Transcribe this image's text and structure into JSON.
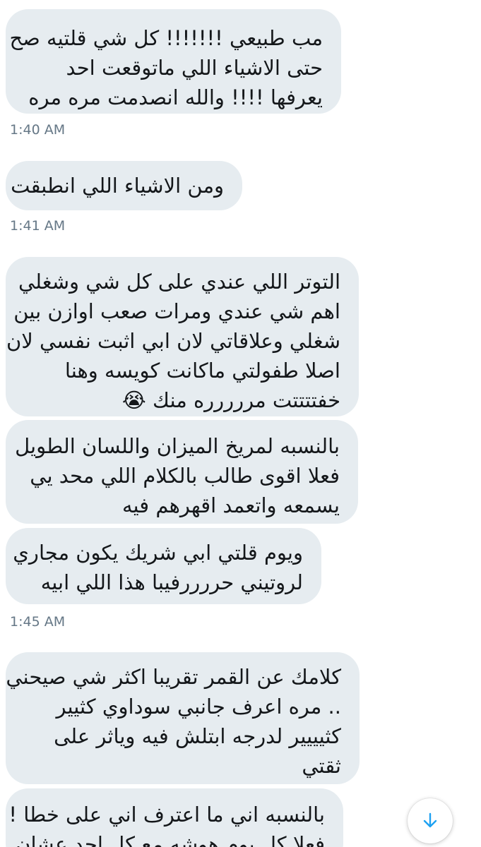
{
  "messages": [
    {
      "lines": [
        "مب طبيعي !!!!!!! كل شي قلتيه صح",
        "حتى الاشياء اللي ماتوقعت احد",
        "يعرفها !!!! والله انصدمت مره مره"
      ]
    },
    {
      "lines": [
        "ومن الاشياء اللي انطبقت"
      ]
    },
    {
      "lines": [
        "التوتر اللي عندي على كل شي وشغلي",
        "اهم شي عندي ومرات صعب اوازن بين",
        "شغلي وعلاقاتي لان ابي اثبت نفسي لان",
        "اصلا طفولتي ماكانت كويسه وهنا",
        "خفتتتتت مررررره منك 😭"
      ]
    },
    {
      "lines": [
        "بالنسبه لمريخ الميزان واللسان الطويل",
        "فعلا اقوى طالب بالكلام اللي محد يي",
        "يسمعه واتعمد اقهرهم فيه"
      ]
    },
    {
      "lines": [
        "ويوم قلتي ابي شريك يكون مجاري",
        "لروتيني حررررفيبا هذا اللي ابيه"
      ]
    },
    {
      "lines": [
        "كلامك عن القمر تقريبا اكثر شي صيحني",
        ".. مره اعرف جانبي سوداوي كثيير",
        "كثيييير لدرجه ابتلش فيه وياثر على",
        "ثقتي"
      ]
    },
    {
      "lines": [
        "بالنسبه اني ما اعترف اني على خطا !",
        "فعلا كل يوم هوشه مع كل احد عشان"
      ]
    }
  ],
  "timestamps": [
    "1:40 AM",
    "1:41 AM",
    "1:45 AM"
  ],
  "scroll_button": {
    "icon": "arrow-down-icon",
    "color": "#1da1f2"
  },
  "colors": {
    "bubble": "#e6ecf0",
    "text": "#14171a",
    "timestamp": "#657786"
  }
}
